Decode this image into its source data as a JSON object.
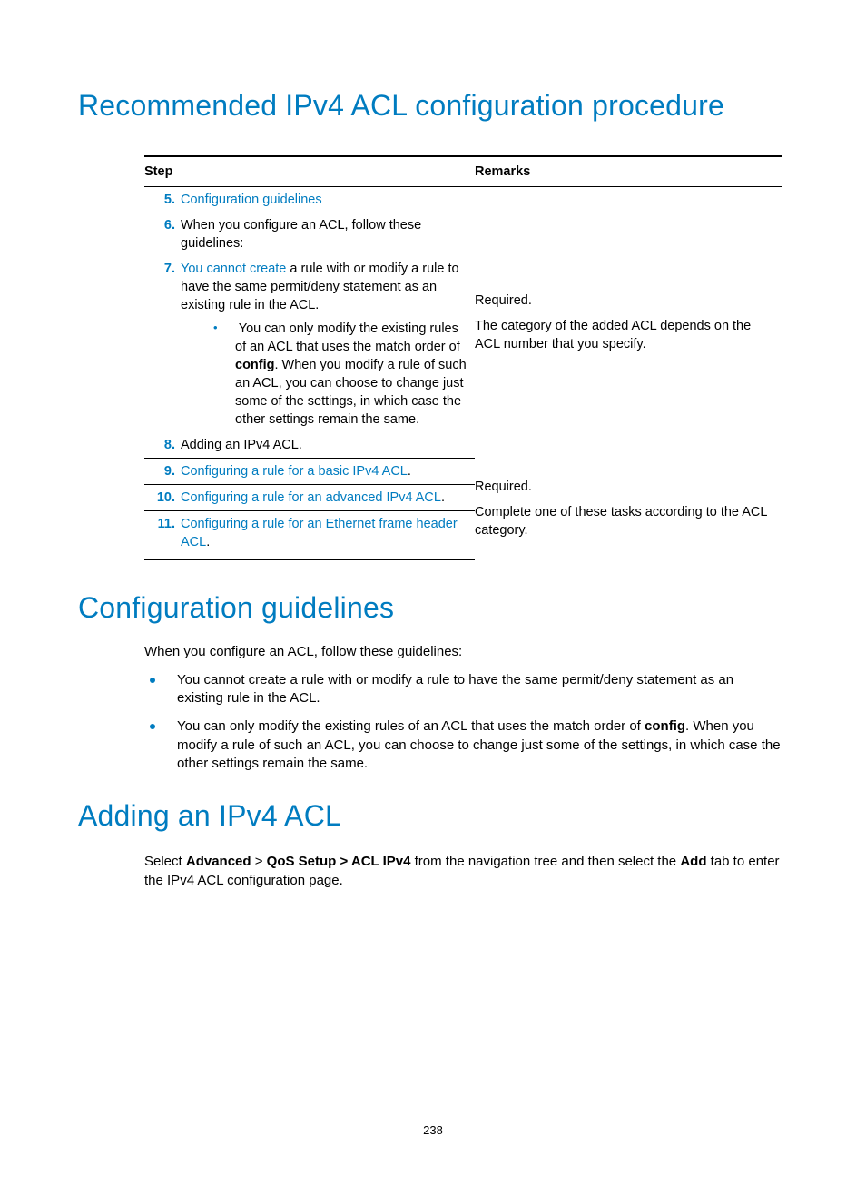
{
  "headings": {
    "h1": "Recommended IPv4 ACL configuration procedure",
    "h2": "Configuration guidelines",
    "h3": "Adding an IPv4 ACL"
  },
  "table": {
    "headers": {
      "step": "Step",
      "remarks": "Remarks"
    },
    "group1": {
      "r5": {
        "num": "5.",
        "text": "Configuration guidelines"
      },
      "r6": {
        "num": "6.",
        "text": "When you configure an ACL, follow these guidelines:"
      },
      "r7": {
        "num": "7.",
        "lead_link": "You cannot create",
        "lead_rest": " a rule with or modify a rule to have the same permit/deny statement as an existing rule in the ACL.",
        "bullet_pre": "You can only modify the existing rules of an ACL that uses the match order of ",
        "bullet_bold": "config",
        "bullet_post": ". When you modify a rule of such an ACL, you can choose to change just some of the settings, in which case the other settings remain the same."
      },
      "r8": {
        "num": "8.",
        "text": "Adding an IPv4 ACL."
      },
      "remarks": {
        "l1": "Required.",
        "l2": "The category of the added ACL depends on the ACL number that you specify."
      }
    },
    "group2": {
      "r9": {
        "num": "9.",
        "text": "Configuring a rule for a basic IPv4 ACL",
        "dot": "."
      },
      "r10": {
        "num": "10.",
        "text": "Configuring a rule for an advanced IPv4 ACL",
        "dot": "."
      },
      "r11": {
        "num": "11.",
        "text": "Configuring a rule for an Ethernet frame header ACL",
        "dot": "."
      },
      "remarks": {
        "l1": "Required.",
        "l2": "Complete one of these tasks according to the ACL category."
      }
    }
  },
  "guidelines": {
    "intro": "When you configure an ACL, follow these guidelines:",
    "b1": "You cannot create a rule with or modify a rule to have the same permit/deny statement as an existing rule in the ACL.",
    "b2_pre": "You can only modify the existing rules of an ACL that uses the match order of ",
    "b2_bold": "config",
    "b2_post": ". When you modify a rule of such an ACL, you can choose to change just some of the settings, in which case the other settings remain the same."
  },
  "adding": {
    "t1": "Select ",
    "b1": "Advanced",
    "t2": " > ",
    "b2": "QoS Setup > ACL IPv4",
    "t3": " from the navigation tree and then select the ",
    "b3": "Add",
    "t4": " tab to enter the IPv4 ACL configuration page."
  },
  "page_number": "238"
}
